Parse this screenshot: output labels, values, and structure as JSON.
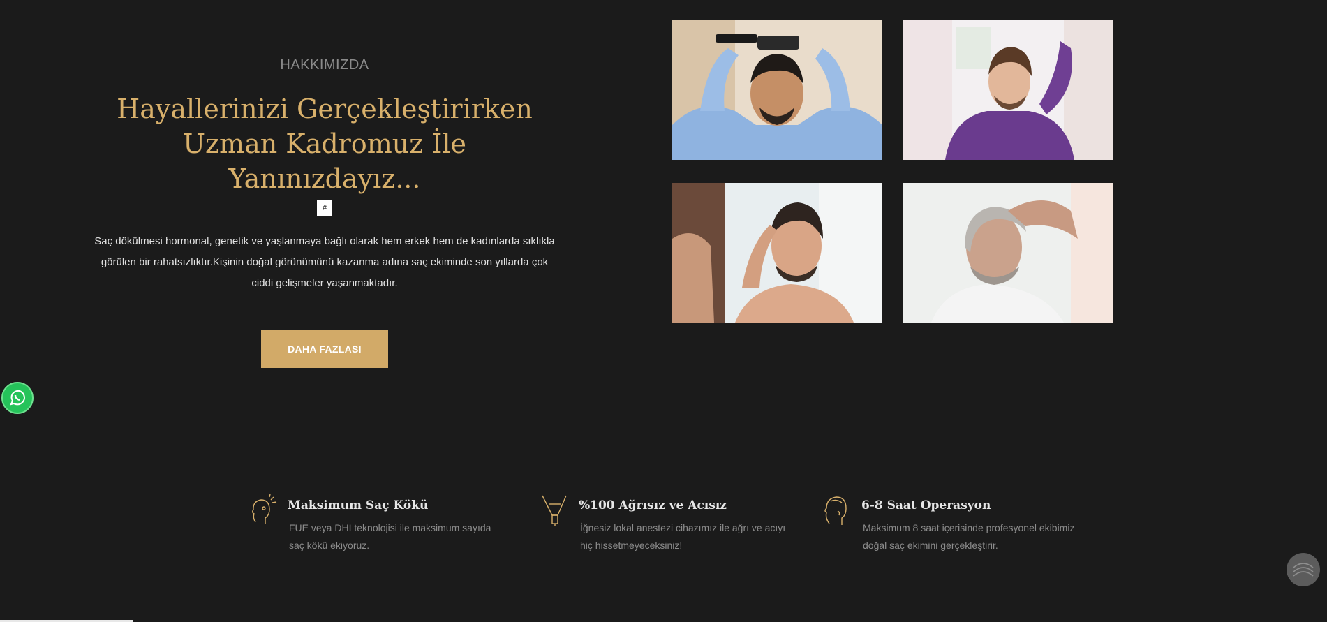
{
  "about": {
    "eyebrow": "HAKKIMIZDA",
    "headline": "Hayallerinizi Gerçekleştirirken Uzman Kadromuz İle Yanınızdayız...",
    "badge": "#",
    "lead": "Saç dökülmesi hormonal, genetik ve yaşlanmaya bağlı olarak hem erkek hem de kadınlarda sıklıkla görülen bir rahatsızlıktır.Kişinin doğal görünümünü kazanma adına saç ekiminde son yıllarda çok ciddi gelişmeler yaşanmaktadır.",
    "button_label": "DAHA FAZLASI"
  },
  "features": [
    {
      "icon": "head-sparkle-icon",
      "title": "Maksimum Saç Kökü",
      "text": "FUE veya DHI teknolojisi ile maksimum sayıda saç kökü ekiyoruz."
    },
    {
      "icon": "needle-tool-icon",
      "title": "%100 Ağrısız ve Acısız",
      "text": "İğnesiz lokal anestezi cihazımız ile ağrı ve acıyı hiç hissetmeyeceksiniz!"
    },
    {
      "icon": "head-profile-icon",
      "title": "6-8 Saat Operasyon",
      "text": "Maksimum 8 saat içerisinde profesyonel ekibimiz doğal saç ekimini gerçekleştirir."
    }
  ],
  "colors": {
    "background": "#1b1b1b",
    "accent_gold": "#d8b06b",
    "button_gold": "#d2aa68",
    "whatsapp_green": "#25c35a"
  }
}
